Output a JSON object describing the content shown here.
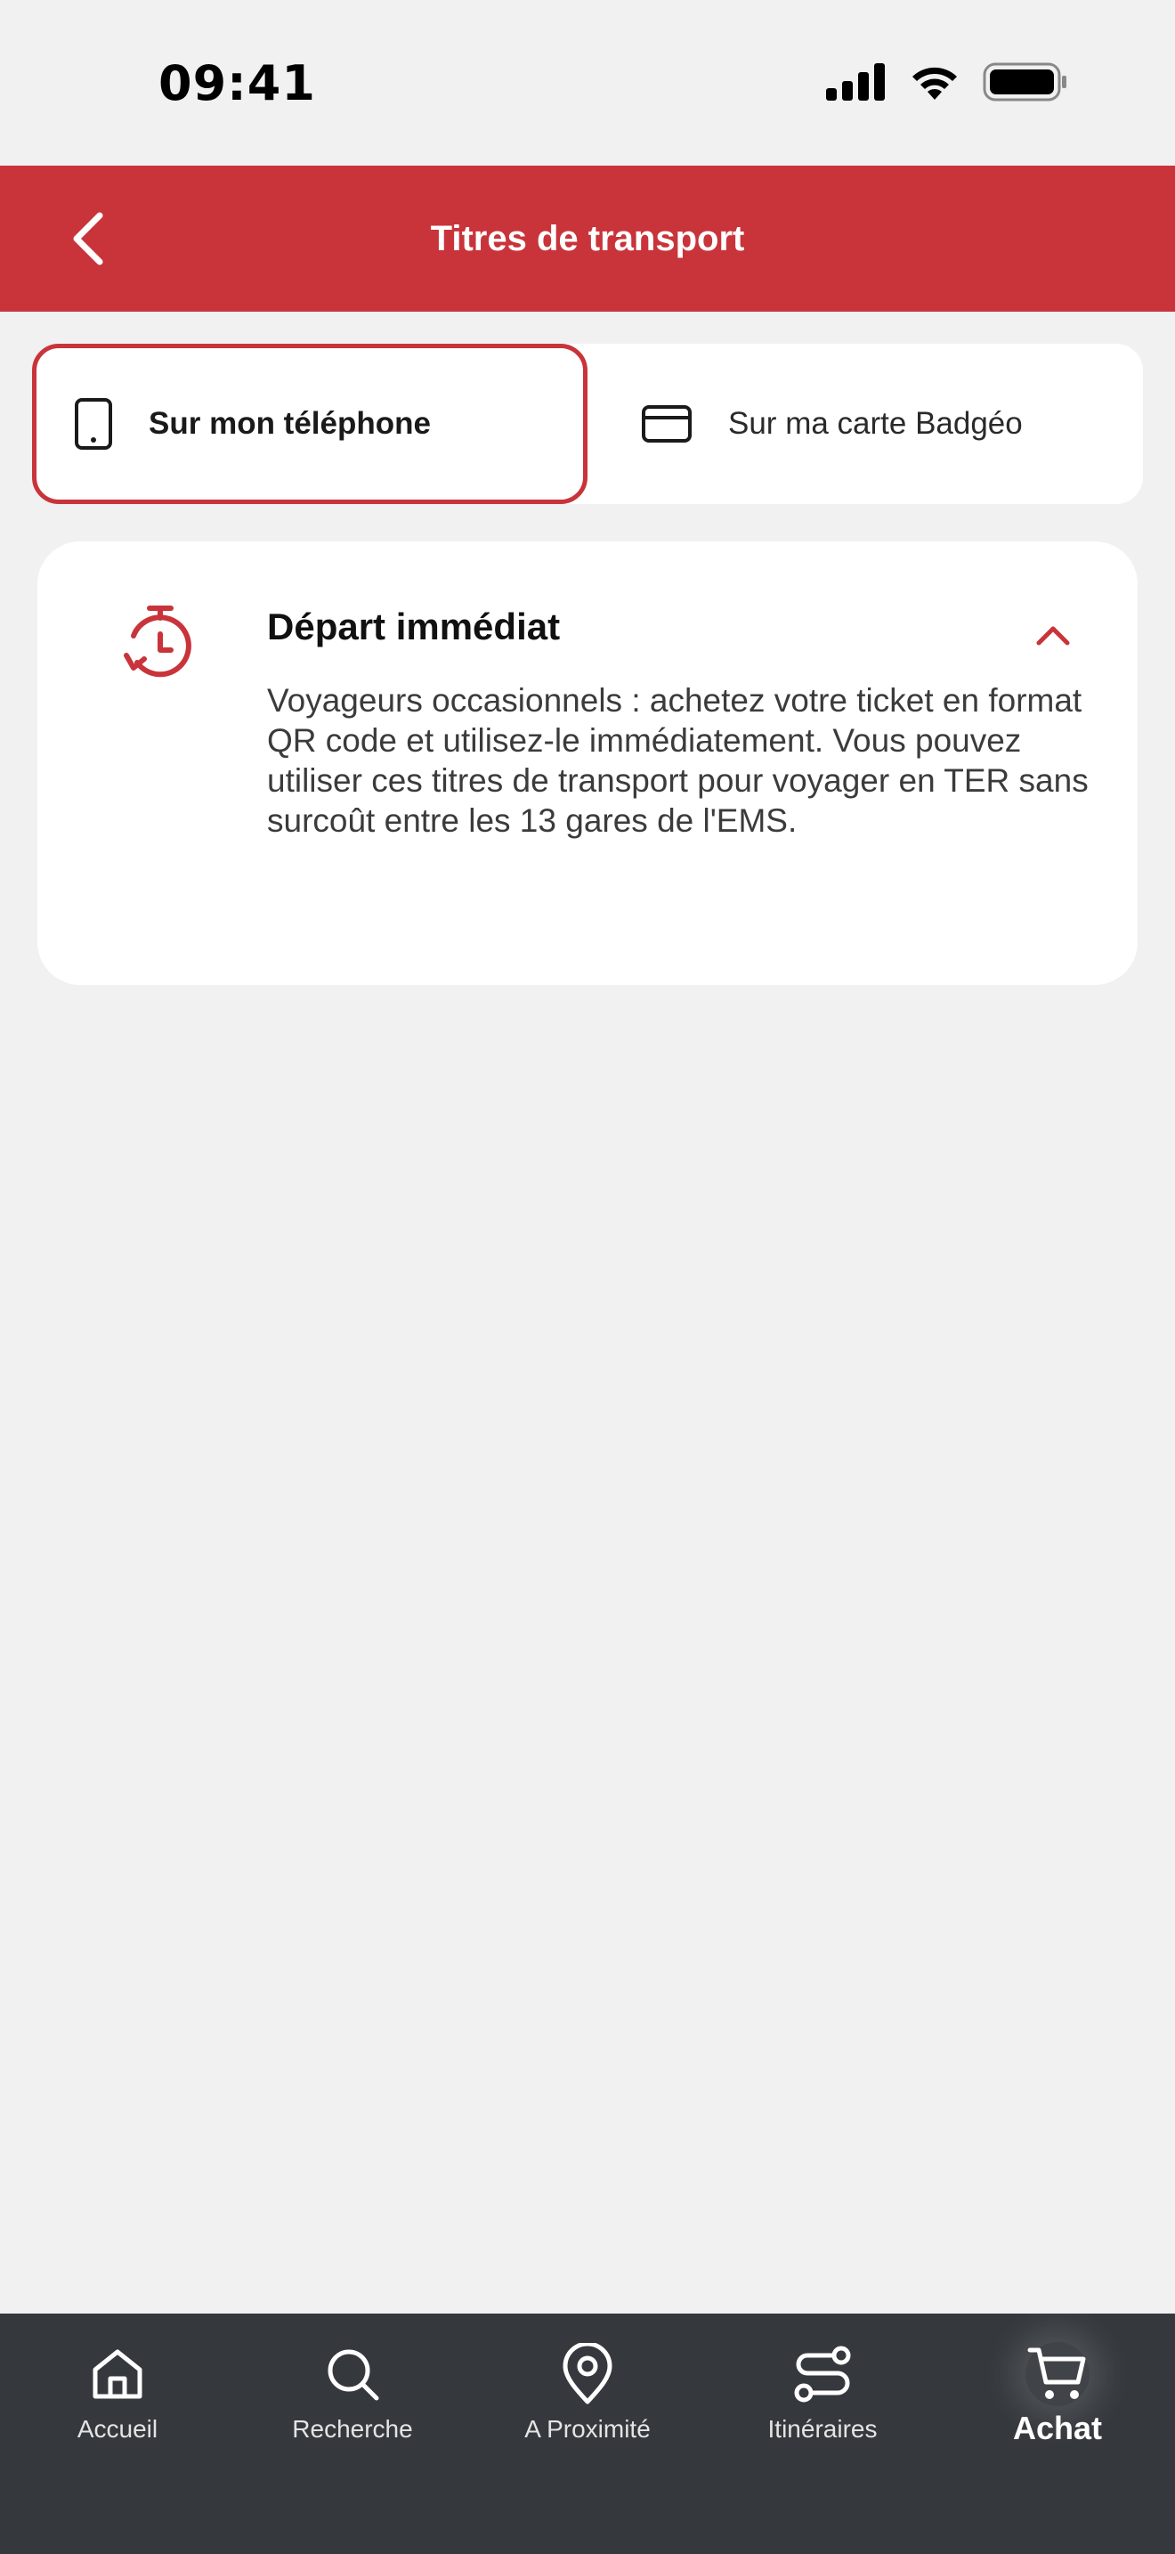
{
  "status_bar": {
    "time": "09:41",
    "icons": [
      "cellular-signal-icon",
      "wifi-icon",
      "battery-icon"
    ]
  },
  "header": {
    "back_icon": "chevron-left-icon",
    "title": "Titres de transport"
  },
  "segment": {
    "options": [
      {
        "label": "Sur mon téléphone",
        "icon": "smartphone-icon",
        "selected": true
      },
      {
        "label": "Sur ma carte Badgéo",
        "icon": "credit-card-icon",
        "selected": false
      }
    ]
  },
  "card": {
    "icon": "timer-refresh-icon",
    "title": "Départ immédiat",
    "expanded": true,
    "toggle_icon": "chevron-up-icon",
    "description": "Voyageurs occasionnels : achetez votre ticket en format QR code et utilisez-le immédiatement. Vous pouvez utiliser ces titres de transport pour voyager en TER sans surcoût entre les 13 gares de l'EMS."
  },
  "tabbar": {
    "items": [
      {
        "label": "Accueil",
        "icon": "home-icon",
        "active": false
      },
      {
        "label": "Recherche",
        "icon": "search-icon",
        "active": false
      },
      {
        "label": "A Proximité",
        "icon": "location-pin-icon",
        "active": false
      },
      {
        "label": "Itinéraires",
        "icon": "route-icon",
        "active": false
      },
      {
        "label": "Achat",
        "icon": "cart-icon",
        "active": true
      }
    ]
  },
  "colors": {
    "brand_red": "#c8343a",
    "background": "#f1f1f1",
    "tabbar_bg": "#35393d",
    "card_bg": "#ffffff"
  }
}
